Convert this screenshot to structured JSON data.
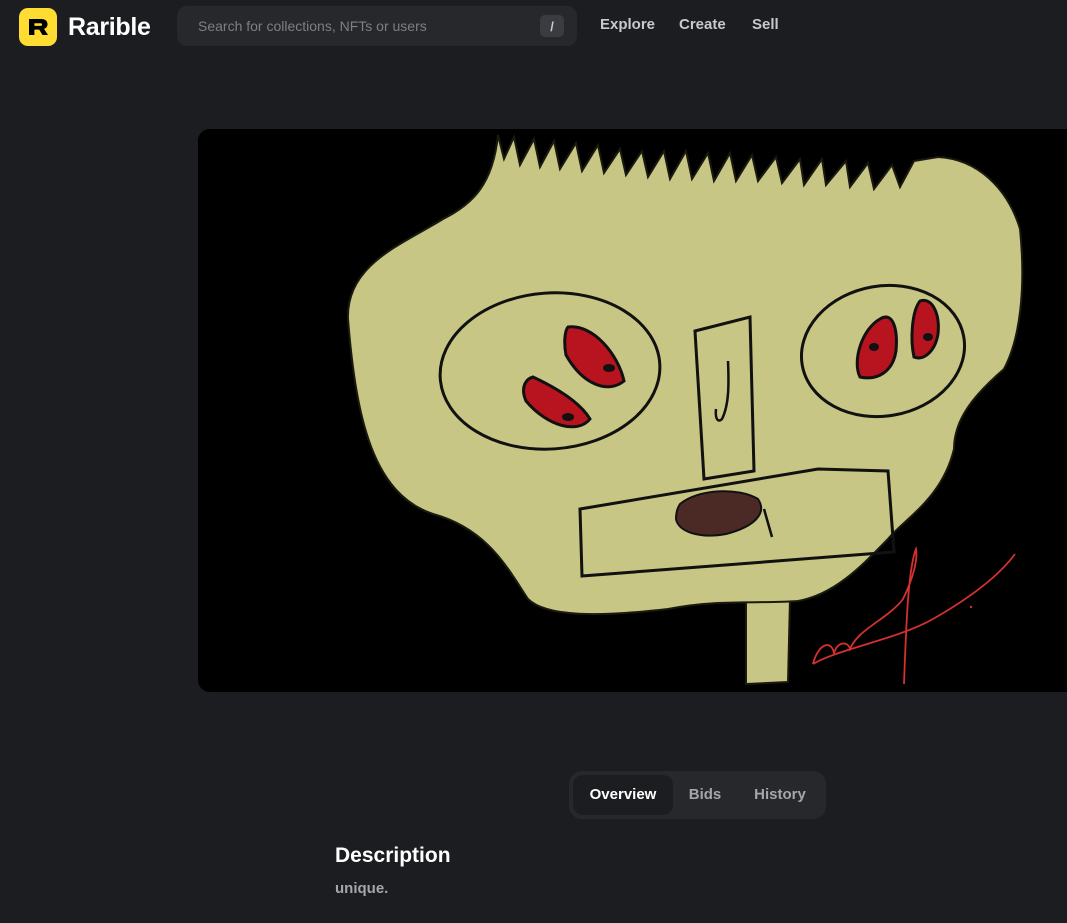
{
  "brand": {
    "name": "Rarible",
    "logo_letter": "R",
    "accent": "#fedc31"
  },
  "search": {
    "placeholder": "Search for collections, NFTs or users",
    "shortcut": "/"
  },
  "nav": {
    "explore": "Explore",
    "create": "Create",
    "sell": "Sell"
  },
  "media": {
    "icon": "nft-artwork-yellow-face"
  },
  "tabs": [
    {
      "label": "Overview",
      "active": true
    },
    {
      "label": "Bids",
      "active": false
    },
    {
      "label": "History",
      "active": false
    }
  ],
  "description": {
    "title": "Description",
    "text": "unique."
  },
  "colors": {
    "background": "#1b1d20",
    "surface": "#26282c",
    "muted_text": "#a4a6ab"
  }
}
